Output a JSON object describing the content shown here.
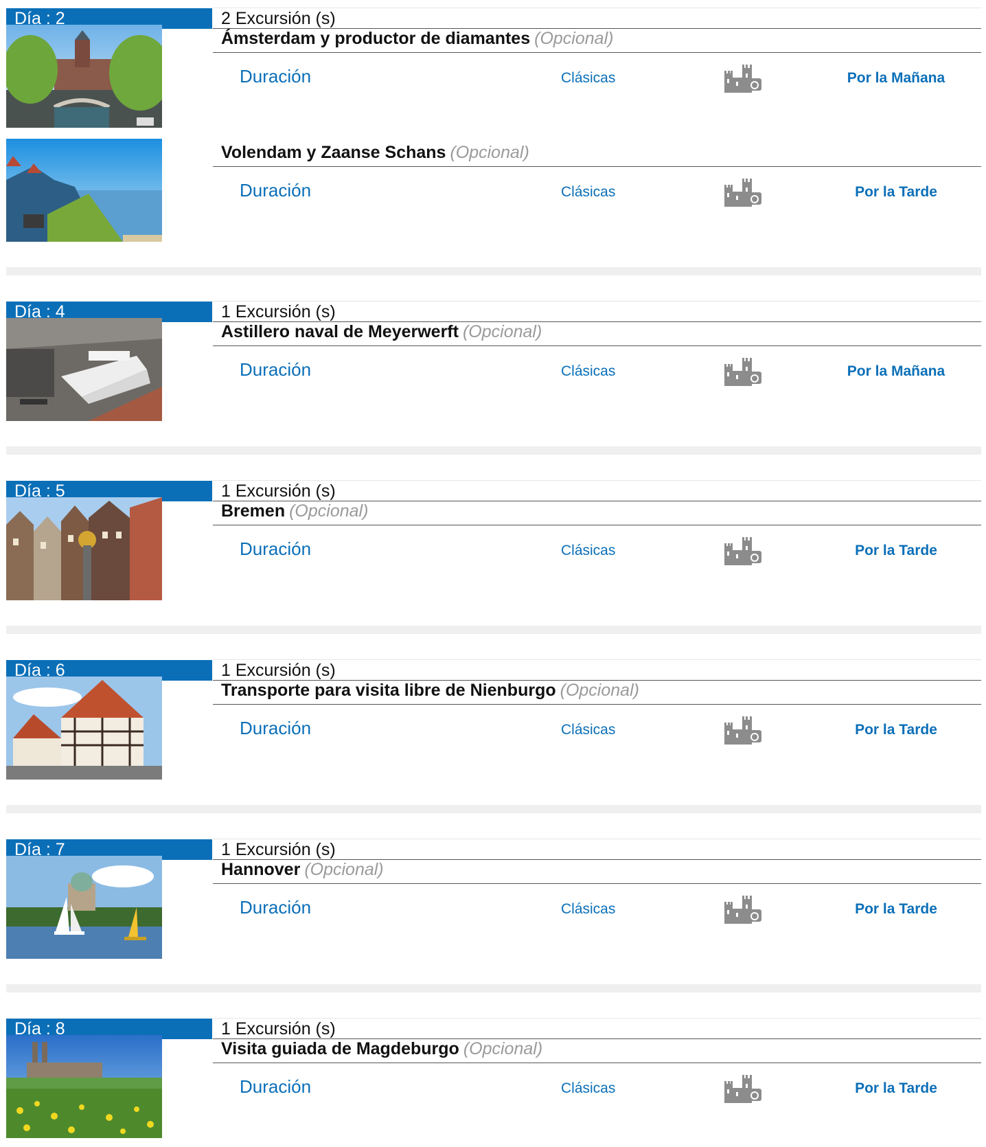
{
  "colors": {
    "accent": "#0b6fb8",
    "optional": "#9a9a9a",
    "separator": "#efefef"
  },
  "days": [
    {
      "label": "Día : 2",
      "count": "2 Excursión (s)",
      "excursions": [
        {
          "name": "Ámsterdam y productor de diamantes",
          "optional": "(Opcional)",
          "duration": "Duración",
          "category": "Clásicas",
          "icon": "castle-camera-icon",
          "time": "Por la Mañana",
          "photo": "amsterdam-canal-photo"
        },
        {
          "name": "Volendam y Zaanse Schans",
          "optional": "(Opcional)",
          "duration": "Duración",
          "category": "Clásicas",
          "icon": "castle-camera-icon",
          "time": "Por la Tarde",
          "photo": "volendam-coast-photo"
        }
      ]
    },
    {
      "label": "Día : 4",
      "count": "1 Excursión (s)",
      "excursions": [
        {
          "name": "Astillero naval de Meyerwerft",
          "optional": "(Opcional)",
          "duration": "Duración",
          "category": "Clásicas",
          "icon": "castle-camera-icon",
          "time": "Por la Mañana",
          "photo": "meyerwerft-shipyard-photo"
        }
      ]
    },
    {
      "label": "Día : 5",
      "count": "1 Excursión (s)",
      "excursions": [
        {
          "name": "Bremen",
          "optional": "(Opcional)",
          "duration": "Duración",
          "category": "Clásicas",
          "icon": "castle-camera-icon",
          "time": "Por la Tarde",
          "photo": "bremen-facades-photo"
        }
      ]
    },
    {
      "label": "Día : 6",
      "count": "1 Excursión (s)",
      "excursions": [
        {
          "name": "Transporte para visita libre de Nienburgo",
          "optional": "(Opcional)",
          "duration": "Duración",
          "category": "Clásicas",
          "icon": "castle-camera-icon",
          "time": "Por la Tarde",
          "photo": "nienburg-timber-house-photo"
        }
      ]
    },
    {
      "label": "Día : 7",
      "count": "1 Excursión (s)",
      "excursions": [
        {
          "name": "Hannover",
          "optional": "(Opcional)",
          "duration": "Duración",
          "category": "Clásicas",
          "icon": "castle-camera-icon",
          "time": "Por la Tarde",
          "photo": "hannover-lake-photo"
        }
      ]
    },
    {
      "label": "Día : 8",
      "count": "1 Excursión (s)",
      "excursions": [
        {
          "name": "Visita guiada de Magdeburgo",
          "optional": "(Opcional)",
          "duration": "Duración",
          "category": "Clásicas",
          "icon": "castle-camera-icon",
          "time": "Por la Tarde",
          "photo": "magdeburg-cathedral-photo"
        }
      ]
    }
  ]
}
